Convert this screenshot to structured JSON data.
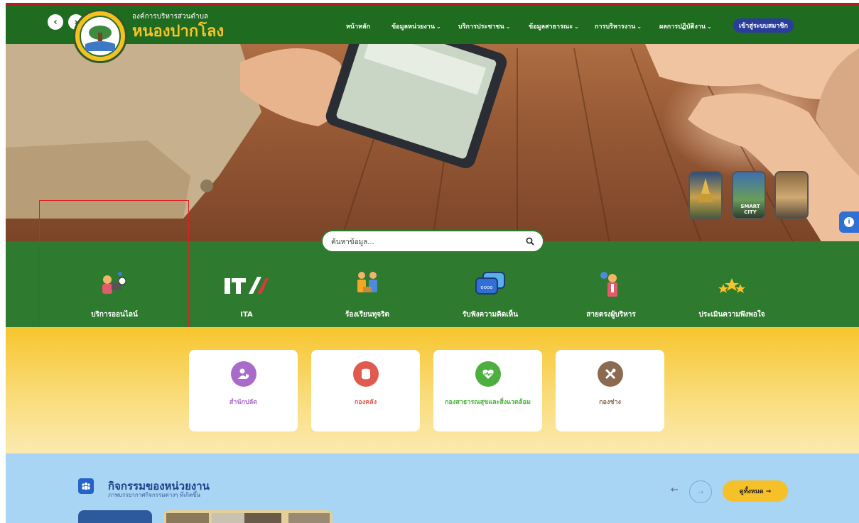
{
  "header": {
    "org_small": "องค์การบริหารส่วนตำบล",
    "org_name": "หนองปากโลง",
    "menu": [
      {
        "label": "หน้าหลัก",
        "chevron": ""
      },
      {
        "label": "ข้อมูลหน่วยงาน",
        "chevron": "⌄"
      },
      {
        "label": "บริการประชาชน",
        "chevron": "⌄"
      },
      {
        "label": "ข้อมูลสาธารณะ",
        "chevron": "⌄"
      },
      {
        "label": "การบริหารงาน",
        "chevron": "⌄"
      },
      {
        "label": "ผลการปฏิบัติงาน",
        "chevron": "⌄"
      }
    ],
    "login_label": "เข้าสู่ระบบสมาชิก",
    "prev_icon": "chevron-left-icon",
    "next_icon": "chevron-right-icon",
    "prev_glyph": "‹",
    "next_glyph": "›"
  },
  "hero": {
    "thumb_smart_city_text": "SMART CITY"
  },
  "search": {
    "placeholder": "ค้นหาข้อมูล...",
    "icon": "search-icon"
  },
  "services": [
    {
      "label": "บริการออนไลน์",
      "icon": "online-service-icon"
    },
    {
      "label": "ITA",
      "icon": "ita-logo-icon"
    },
    {
      "label": "ร้องเรียนทุจริต",
      "icon": "corruption-complaint-icon"
    },
    {
      "label": "รับฟังความคิดเห็น",
      "icon": "chat-bubbles-icon"
    },
    {
      "label": "สายตรงผู้บริหาร",
      "icon": "executive-hotline-icon"
    },
    {
      "label": "ประเมินความพึงพอใจ",
      "icon": "stars-icon"
    }
  ],
  "departments": [
    {
      "label": "สำนักปลัด",
      "icon": "user-shield-icon",
      "color": "#a96bc9"
    },
    {
      "label": "กองคลัง",
      "icon": "coins-icon",
      "color": "#e05a4e"
    },
    {
      "label": "กองสาธารณสุขและสิ่งแวดล้อม",
      "icon": "heart-pulse-icon",
      "color": "#4caf3e"
    },
    {
      "label": "กองช่าง",
      "icon": "tools-icon",
      "color": "#8b6a52"
    }
  ],
  "activities": {
    "title": "กิจกรรมของหน่วยงาน",
    "subtitle": "ภาพบรรยากาศกิจกรรมต่างๆ ที่เกิดขึ้น",
    "prev_glyph": "←",
    "next_glyph": "→",
    "all_label": "ดูทั้งหมด →"
  },
  "colors": {
    "header_green": "#1f6b1f",
    "service_green": "#2e7a2e",
    "accent_yellow": "#f6c028",
    "login_blue": "#2a3d9b",
    "highlight_red": "#e02020"
  }
}
